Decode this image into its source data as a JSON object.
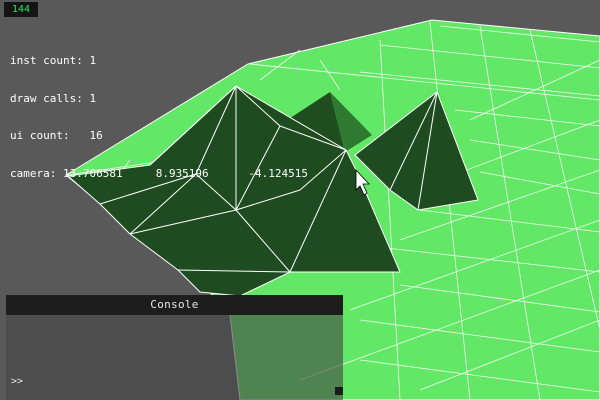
{
  "hud": {
    "fps": "144",
    "stats": [
      "inst count: 1",
      "draw calls: 1",
      "ui count:   16",
      "camera: 13.706581     8.935196      -4.124515"
    ]
  },
  "console": {
    "title": "Console",
    "prompt": ">>"
  },
  "colors": {
    "background": "#595959",
    "terrain_light": "#61e765",
    "terrain_dark": "#1e4b1f",
    "wireframe": "#ffffff"
  }
}
